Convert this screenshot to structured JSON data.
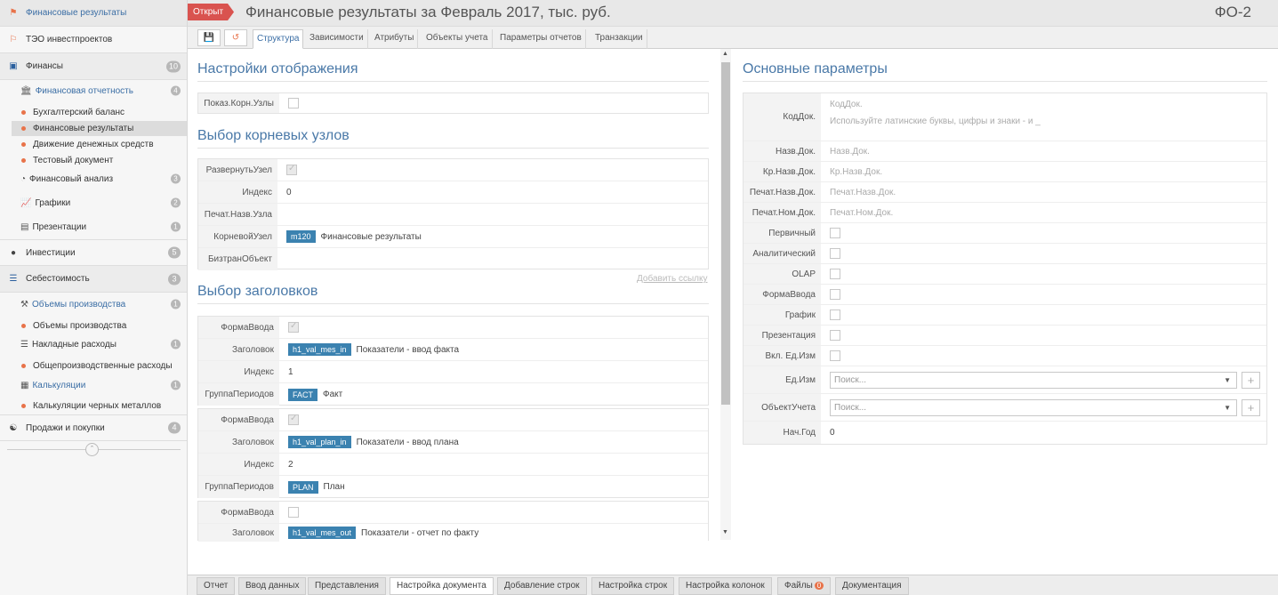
{
  "sidebar": {
    "top1": "Финансовые результаты",
    "top2": "ТЭО инвестпроектов",
    "finance": {
      "label": "Финансы",
      "count": "10"
    },
    "fin_reports": {
      "label": "Финансовая отчетность",
      "count": "4"
    },
    "leaf_balance": "Бухгалтерский баланс",
    "leaf_finres": "Финансовые результаты",
    "leaf_cash": "Движение денежных средств",
    "leaf_test": "Тестовый документ",
    "fin_analysis": {
      "label": "Финансовый анализ",
      "count": "3"
    },
    "charts": {
      "label": "Графики",
      "count": "2"
    },
    "presentations": {
      "label": "Презентации",
      "count": "1"
    },
    "invest": {
      "label": "Инвестиции",
      "count": "5"
    },
    "cost": {
      "label": "Себестоимость",
      "count": "3"
    },
    "prod_vol": {
      "label": "Объемы производства",
      "count": "1"
    },
    "leaf_prod_vol": "Объемы производства",
    "overhead": {
      "label": "Накладные расходы",
      "count": "1"
    },
    "leaf_overhead": "Общепроизводственные расходы",
    "calc": {
      "label": "Калькуляции",
      "count": "1"
    },
    "leaf_calc": "Калькуляции черных металлов",
    "sales": {
      "label": "Продажи и покупки",
      "count": "4"
    }
  },
  "header": {
    "status": "Открыт",
    "title": "Финансовые результаты за Февраль 2017, тыс. руб.",
    "code": "ФО-2"
  },
  "tabs": [
    "Структура",
    "Зависимости",
    "Атрибуты",
    "Объекты учета",
    "Параметры отчетов",
    "Транзакции"
  ],
  "display": {
    "title": "Настройки отображения",
    "show_root_label": "Показ.Корн.Узлы"
  },
  "roots": {
    "title": "Выбор корневых узлов",
    "expand": "РазвернутьУзел",
    "index_label": "Индекс",
    "index_val": "0",
    "print_label": "Печат.Назв.Узла",
    "root_label": "КорневойУзел",
    "root_tag": "m120",
    "root_text": "Финансовые результаты",
    "biz_label": "БизтранОбъект",
    "add_link": "Добавить ссылку"
  },
  "headers": {
    "title": "Выбор заголовков",
    "form_label": "ФормаВвода",
    "head_label": "Заголовок",
    "index_label": "Индекс",
    "period_label": "ГруппаПериодов",
    "g1": {
      "tag": "h1_val_mes_in",
      "text": "Показатели - ввод факта",
      "index": "1",
      "ptag": "FACT",
      "ptext": "Факт"
    },
    "g2": {
      "tag": "h1_val_plan_in",
      "text": "Показатели - ввод плана",
      "index": "2",
      "ptag": "PLAN",
      "ptext": "План"
    },
    "g3": {
      "tag": "h1_val_mes_out",
      "text": "Показатели - отчет по факту"
    }
  },
  "params": {
    "title": "Основные параметры",
    "code_label": "КодДок.",
    "code_ph": "КодДок.",
    "code_hint": "Используйте латинские буквы, цифры и знаки - и _",
    "name_label": "Назв.Док.",
    "name_ph": "Назв.Док.",
    "short_label": "Кр.Назв.Док.",
    "short_ph": "Кр.Назв.Док.",
    "pname_label": "Печат.Назв.Док.",
    "pname_ph": "Печат.Назв.Док.",
    "pnum_label": "Печат.Ном.Док.",
    "pnum_ph": "Печат.Ном.Док.",
    "primary": "Первичный",
    "analytic": "Аналитический",
    "olap": "OLAP",
    "form": "ФормаВвода",
    "chart": "График",
    "pres": "Презентация",
    "units_on": "Вкл. Ед.Изм",
    "units_label": "Ед.Изм",
    "units_ph": "Поиск...",
    "obj_label": "ОбъектУчета",
    "obj_ph": "Поиск...",
    "year_label": "Нач.Год",
    "year_val": "0"
  },
  "bottom_tabs": [
    "Отчет",
    "Ввод данных",
    "Представления",
    "Настройка документа",
    "Добавление строк",
    "Настройка строк",
    "Настройка колонок",
    "Файлы",
    "Документация"
  ],
  "files_count": "0"
}
